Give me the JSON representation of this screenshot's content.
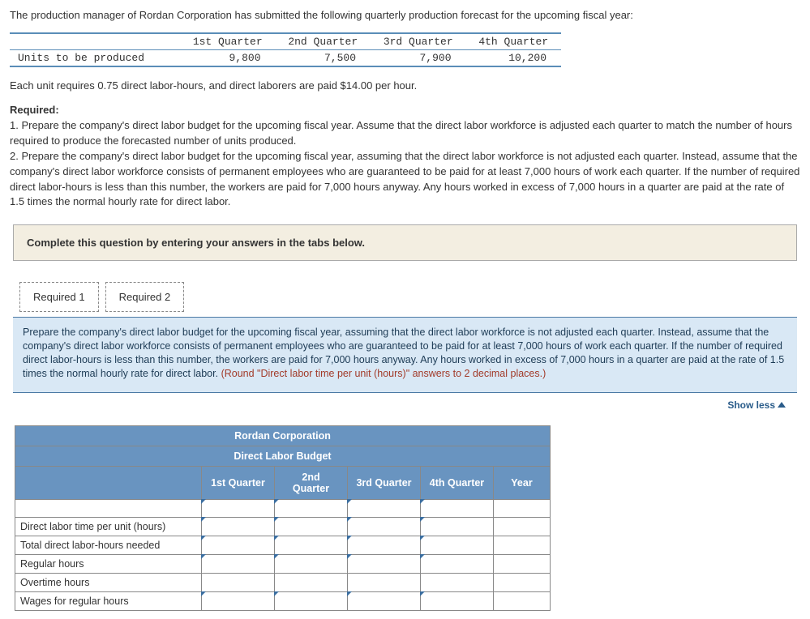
{
  "intro": "The production manager of Rordan Corporation has submitted the following quarterly production forecast for the upcoming fiscal year:",
  "forecast": {
    "rowLabel": "Units to be produced",
    "headers": [
      "1st Quarter",
      "2nd Quarter",
      "3rd Quarter",
      "4th Quarter"
    ],
    "values": [
      "9,800",
      "7,500",
      "7,900",
      "10,200"
    ]
  },
  "para2": "Each unit requires 0.75 direct labor-hours, and direct laborers are paid $14.00 per hour.",
  "requiredHead": "Required:",
  "req1": "1. Prepare the company's direct labor budget for the upcoming fiscal year. Assume that the direct labor workforce is adjusted each quarter to match the number of hours required to produce the forecasted number of units produced.",
  "req2": "2. Prepare the company's direct labor budget for the upcoming fiscal year, assuming that the direct labor workforce is not adjusted each quarter. Instead, assume that the company's direct labor workforce consists of permanent employees who are guaranteed to be paid for at least 7,000 hours of work each quarter. If the number of required direct labor-hours is less than this number, the workers are paid for 7,000 hours anyway. Any hours worked in excess of 7,000 hours in a quarter are paid at the rate of 1.5 times the normal hourly rate for direct labor.",
  "instruction": "Complete this question by entering your answers in the tabs below.",
  "tabs": {
    "t1": "Required 1",
    "t2": "Required 2"
  },
  "promptMain": "Prepare the company's direct labor budget for the upcoming fiscal year, assuming that the direct labor workforce is not adjusted each quarter. Instead, assume that the company's direct labor workforce consists of permanent employees who are guaranteed to be paid for at least 7,000 hours of work each quarter. If the number of required direct labor-hours is less than this number, the workers are paid for 7,000 hours anyway. Any hours worked in excess of 7,000 hours in a quarter are paid at the rate of 1.5 times the normal hourly rate for direct labor. ",
  "promptHint": "(Round \"Direct labor time per unit (hours)\" answers to 2 decimal places.)",
  "showless": "Show less",
  "budget": {
    "title1": "Rordan Corporation",
    "title2": "Direct Labor Budget",
    "cols": [
      "1st Quarter",
      "2nd Quarter",
      "3rd Quarter",
      "4th Quarter",
      "Year"
    ],
    "rows": [
      "",
      "Direct labor time per unit (hours)",
      "Total direct labor-hours needed",
      "Regular hours",
      "Overtime hours",
      "Wages for regular hours"
    ]
  }
}
